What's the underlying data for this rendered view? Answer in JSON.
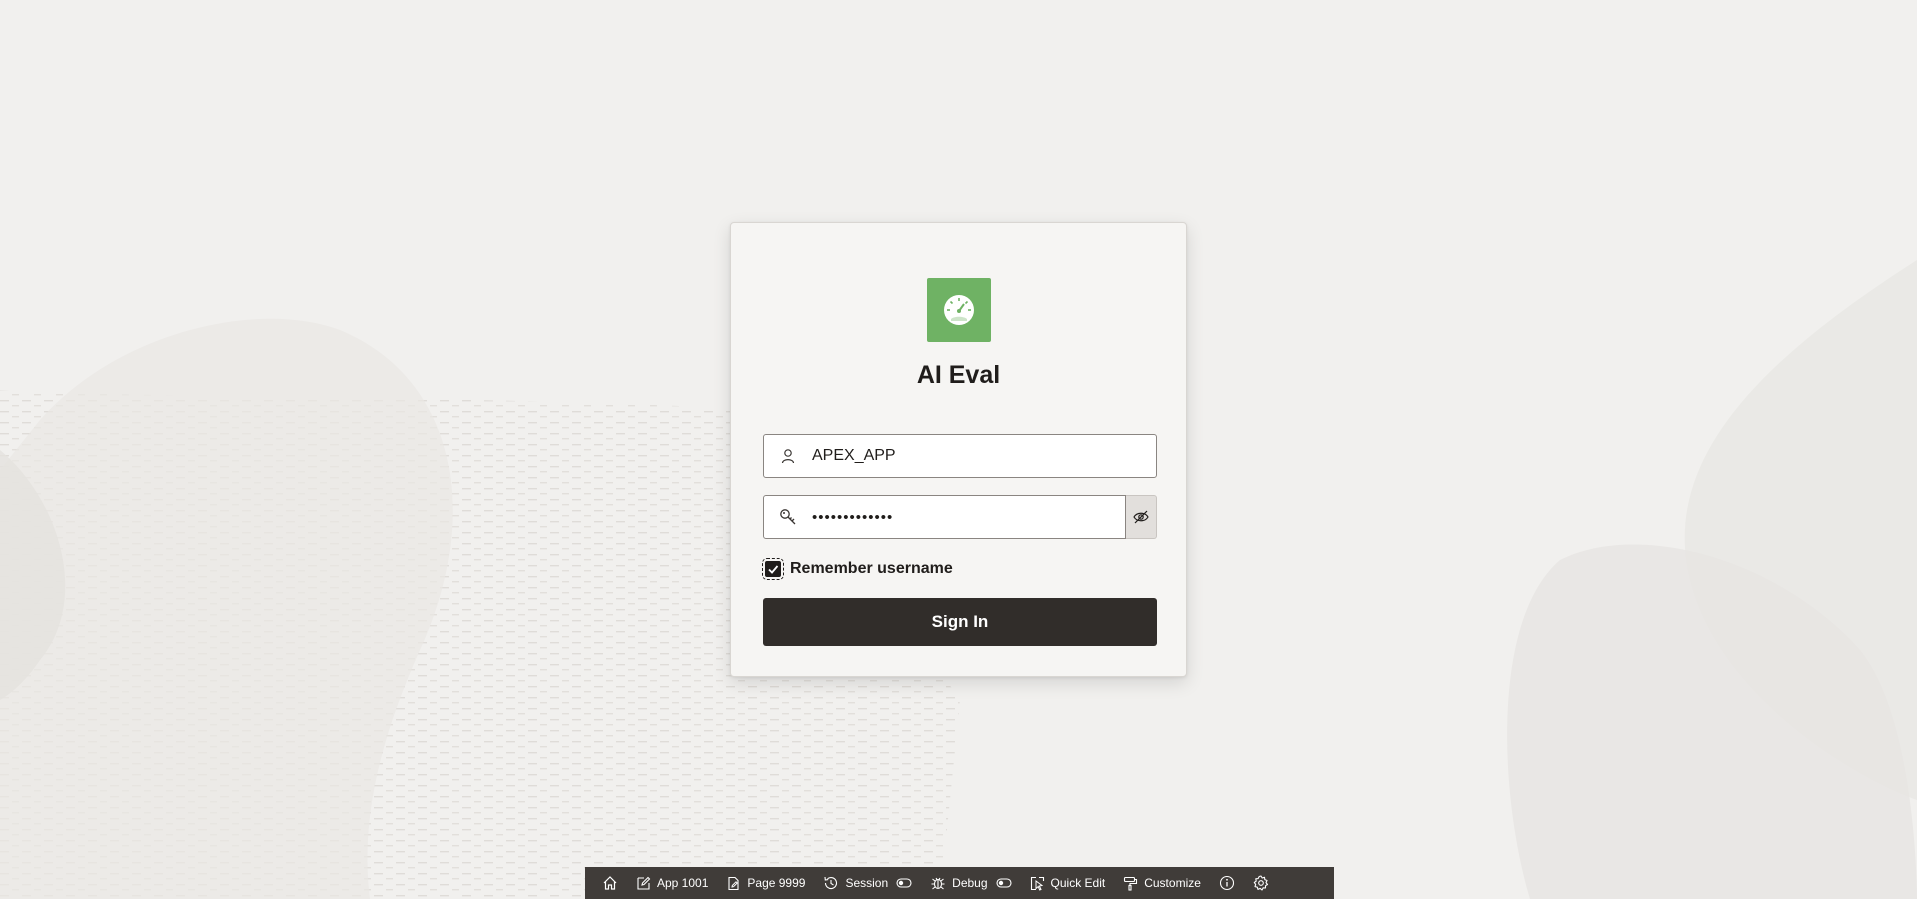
{
  "app": {
    "title": "AI Eval",
    "logo_icon": "speedometer-icon",
    "logo_color": "#6fb264"
  },
  "login": {
    "username_value": "APEX_APP",
    "username_icon": "user-icon",
    "password_value": "•••••••••••••",
    "password_icon": "key-icon",
    "password_toggle_icon": "eye-slash-icon",
    "remember_label": "Remember username",
    "remember_checked": true,
    "signin_label": "Sign In",
    "signin_color": "#312d2a"
  },
  "dev_toolbar": {
    "home_icon": "home-icon",
    "app_label": "App 1001",
    "page_label": "Page 9999",
    "session_label": "Session",
    "debug_label": "Debug",
    "quick_edit_label": "Quick Edit",
    "customize_label": "Customize",
    "info_icon": "info-icon",
    "settings_icon": "gear-icon",
    "background_color": "#403c39"
  }
}
